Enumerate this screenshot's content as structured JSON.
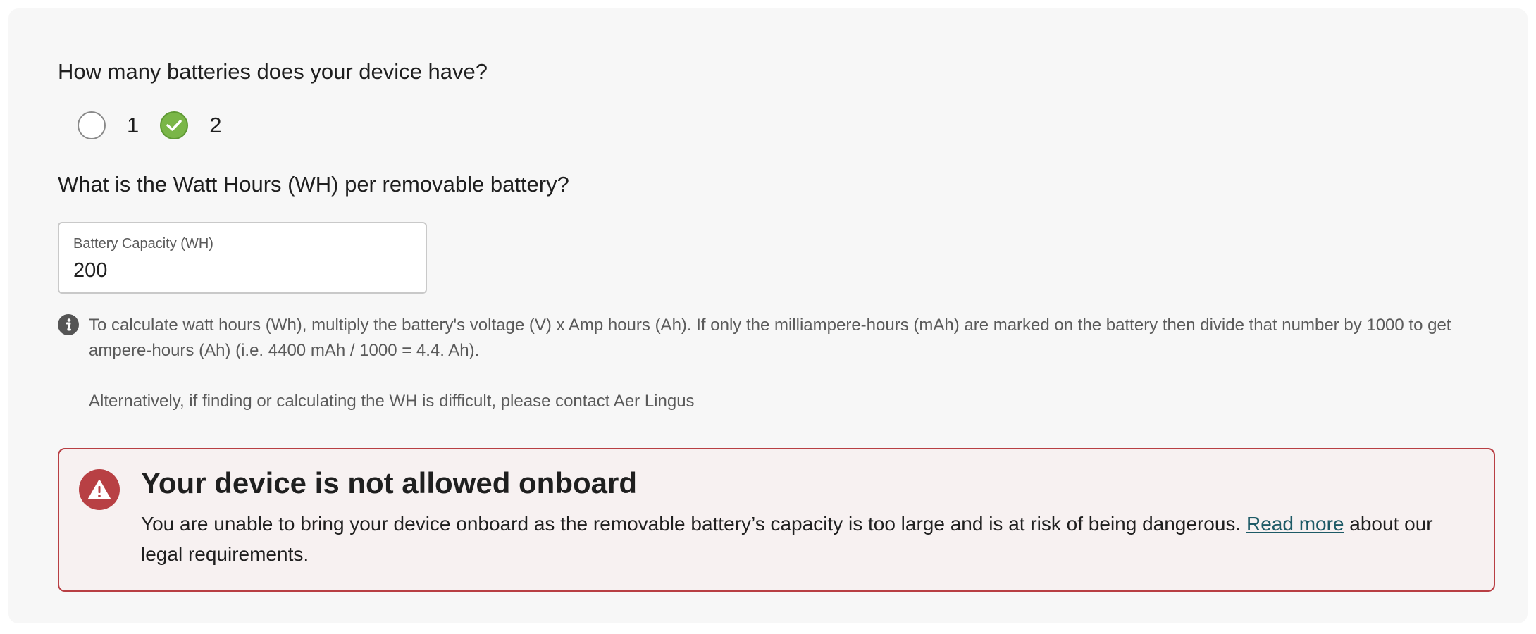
{
  "battery_count": {
    "question": "How many batteries does your device have?",
    "options": [
      {
        "label": "1",
        "selected": false
      },
      {
        "label": "2",
        "selected": true
      }
    ]
  },
  "watt_hours": {
    "question": "What is the Watt Hours (WH) per removable battery?",
    "field_label": "Battery Capacity (WH)",
    "field_value": "200"
  },
  "info": {
    "icon": "info-icon",
    "paragraph_1": "To calculate watt hours (Wh), multiply the battery's voltage (V) x Amp hours (Ah). If only the milliampere-hours (mAh) are marked on the battery then divide that number by 1000 to get ampere-hours (Ah) (i.e. 4400 mAh / 1000 = 4.4. Ah).",
    "paragraph_2": "Alternatively, if finding or calculating the WH is difficult, please contact Aer Lingus"
  },
  "alert": {
    "icon": "warning-icon",
    "title": "Your device is not allowed onboard",
    "body_before_link": "You are unable to bring your device onboard as the removable battery’s capacity is too large and is at risk of being dangerous. ",
    "link_text": "Read more",
    "body_after_link": " about our legal requirements."
  },
  "colors": {
    "selected_radio": "#7ab648",
    "alert_border": "#b83f44",
    "alert_icon": "#b84044",
    "link": "#1d5a66",
    "card_background": "#f7f7f7"
  }
}
